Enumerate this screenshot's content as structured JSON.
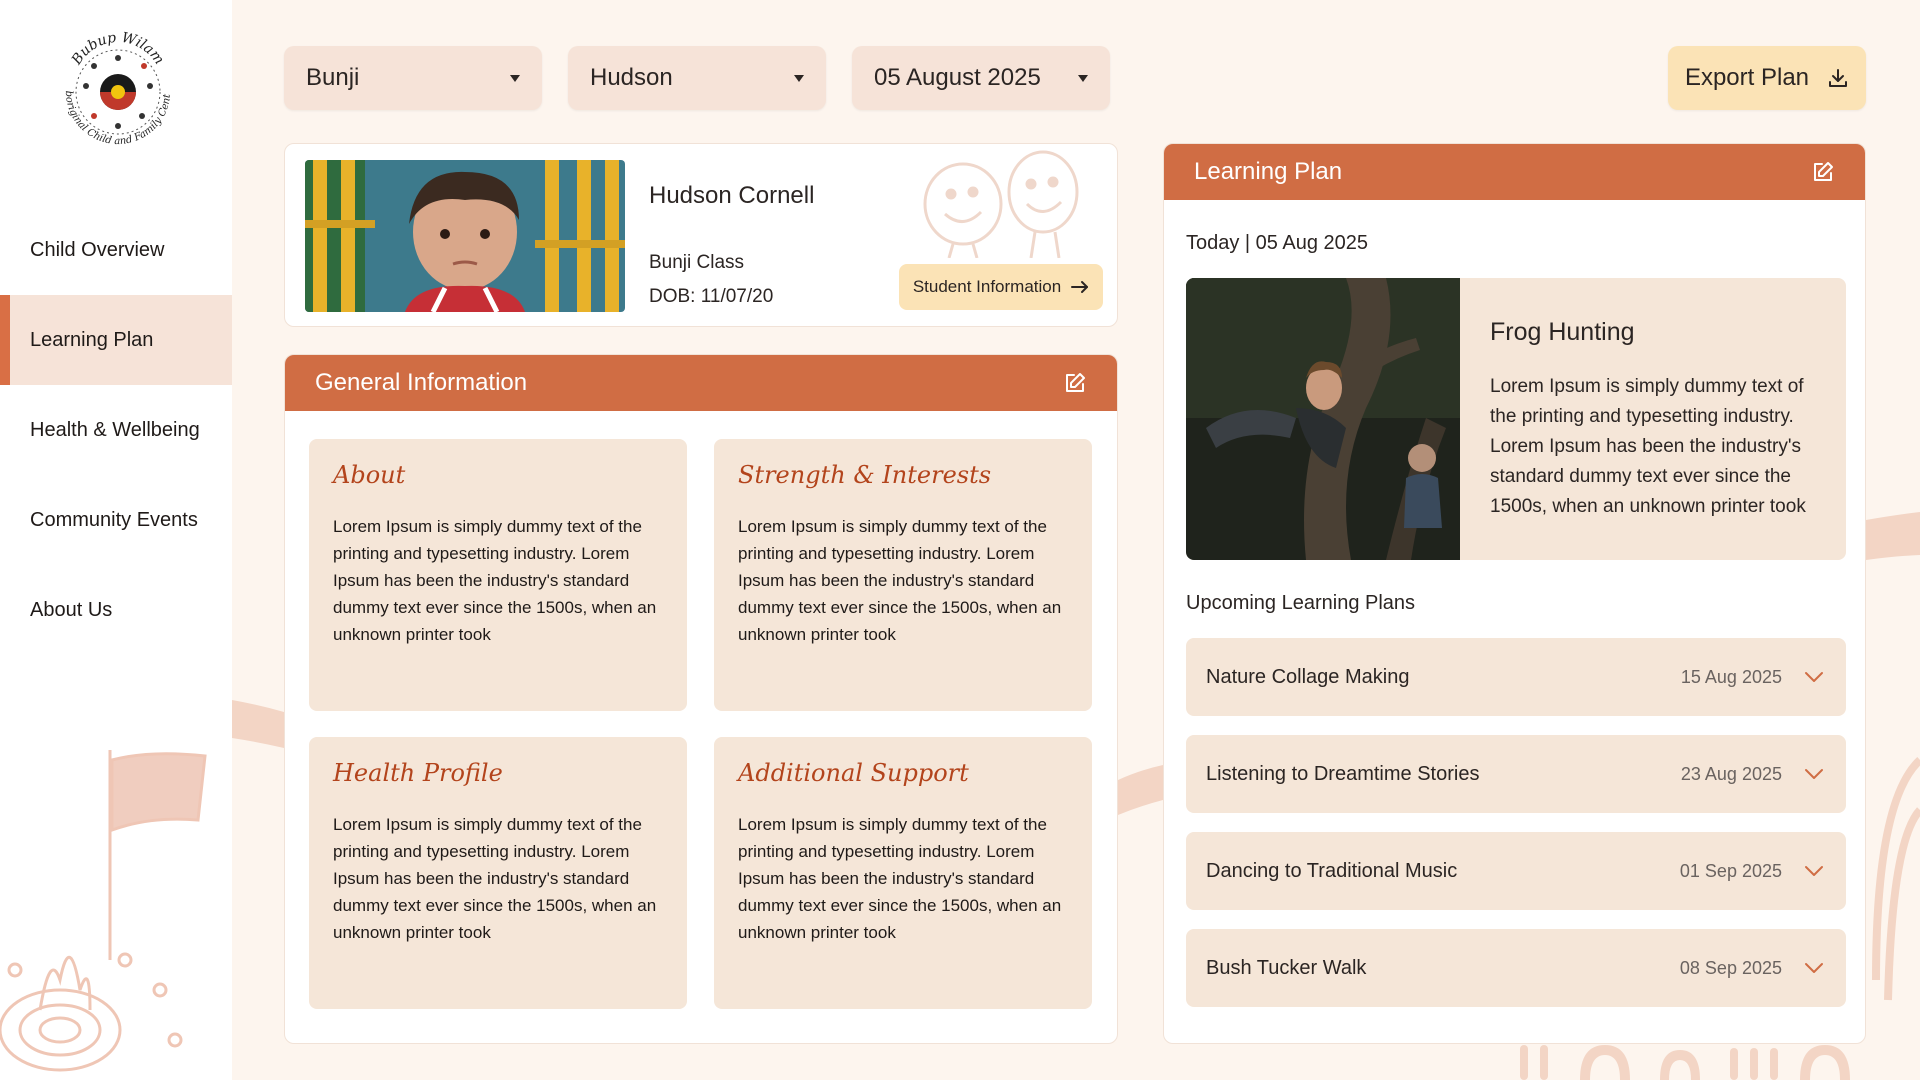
{
  "brand": {
    "name": "Bubup Wilam",
    "subtitle": "Aboriginal Child and Family Centre"
  },
  "sidebar": {
    "items": [
      {
        "label": "Child Overview",
        "active": false
      },
      {
        "label": "Learning Plan",
        "active": true
      },
      {
        "label": "Health & Wellbeing",
        "active": false
      },
      {
        "label": "Community Events",
        "active": false
      },
      {
        "label": "About Us",
        "active": false
      }
    ]
  },
  "filters": {
    "class": "Bunji",
    "child": "Hudson",
    "date": "05 August 2025"
  },
  "export_label": "Export Plan",
  "student": {
    "name": "Hudson Cornell",
    "class": "Bunji Class",
    "dob": "DOB: 11/07/20",
    "info_button": "Student Information"
  },
  "general": {
    "header": "General Information",
    "boxes": [
      {
        "title": "About",
        "text": "Lorem Ipsum is simply dummy text of the printing and typesetting industry. Lorem Ipsum has been the industry's standard dummy text ever since the 1500s, when an unknown printer took"
      },
      {
        "title": "Strength & Interests",
        "text": "Lorem Ipsum is simply dummy text of the printing and typesetting industry. Lorem Ipsum has been the industry's standard dummy text ever since the 1500s, when an unknown printer took"
      },
      {
        "title": "Health Profile",
        "text": "Lorem Ipsum is simply dummy text of the printing and typesetting industry. Lorem Ipsum has been the industry's standard dummy text ever since the 1500s, when an unknown printer took"
      },
      {
        "title": "Additional Support",
        "text": "Lorem Ipsum is simply dummy text of the printing and typesetting industry. Lorem Ipsum has been the industry's standard dummy text ever since the 1500s, when an unknown printer took"
      }
    ]
  },
  "plan": {
    "header": "Learning Plan",
    "today": "Today | 05 Aug 2025",
    "feature": {
      "title": "Frog Hunting",
      "text": "Lorem Ipsum is simply dummy text of the printing and typesetting industry. Lorem Ipsum has been the industry's standard dummy text ever since the 1500s, when an unknown printer took"
    },
    "upcoming_label": "Upcoming Learning Plans",
    "upcoming": [
      {
        "title": "Nature Collage Making",
        "date": "15 Aug 2025"
      },
      {
        "title": "Listening to Dreamtime Stories",
        "date": "23 Aug 2025"
      },
      {
        "title": "Dancing to Traditional Music",
        "date": "01 Sep 2025"
      },
      {
        "title": "Bush Tucker Walk",
        "date": "08 Sep 2025"
      }
    ]
  },
  "colors": {
    "accent": "#d06d44",
    "panel": "#f5e6d8",
    "button": "#fbe3b6",
    "background": "#fdf5ee"
  },
  "icons": {
    "dropdown": "caret-down-icon",
    "export": "download-icon",
    "edit": "edit-icon",
    "arrow": "arrow-right-icon",
    "expand": "chevron-down-icon"
  }
}
